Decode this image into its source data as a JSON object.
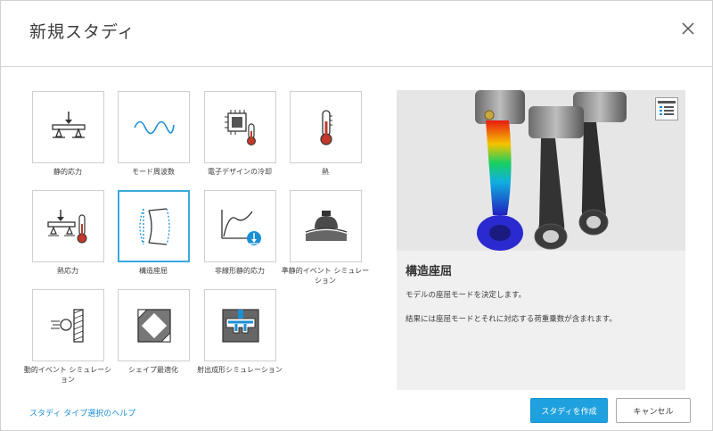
{
  "dialog": {
    "title": "新規スタディ",
    "close_icon": "close-icon"
  },
  "studies": [
    {
      "label": "静的応力",
      "icon": "static-stress-icon"
    },
    {
      "label": "モード周波数",
      "icon": "modal-frequency-icon"
    },
    {
      "label": "電子デザインの冷却",
      "icon": "electronics-cooling-icon"
    },
    {
      "label": "熱",
      "icon": "thermometer-icon"
    },
    {
      "label": "熱応力",
      "icon": "thermal-stress-icon"
    },
    {
      "label": "構造座屈",
      "icon": "structural-buckling-icon",
      "selected": true
    },
    {
      "label": "非線形静的応力",
      "icon": "nonlinear-static-stress-icon"
    },
    {
      "label": "準静的イベント シミュレーション",
      "icon": "quasi-static-event-icon"
    },
    {
      "label": "動的イベント シミュレーション",
      "icon": "dynamic-event-icon"
    },
    {
      "label": "シェイプ最適化",
      "icon": "shape-optimization-icon"
    },
    {
      "label": "射出成形シミュレーション",
      "icon": "injection-molding-icon"
    }
  ],
  "preview": {
    "title": "構造座屈",
    "description_1": "モデルの座屈モードを決定します。",
    "description_2": "結果には座屈モードとそれに対応する荷重乗数が含まれます。",
    "legend_icon": "legend-icon",
    "image": "connecting-rods-buckling-result"
  },
  "footer": {
    "help_link": "スタディ タイプ選択のヘルプ",
    "create_button": "スタディを作成",
    "cancel_button": "キャンセル"
  },
  "colors": {
    "accent": "#1ea1de",
    "selected_border": "#3da8dc",
    "link": "#1a8fd6"
  }
}
